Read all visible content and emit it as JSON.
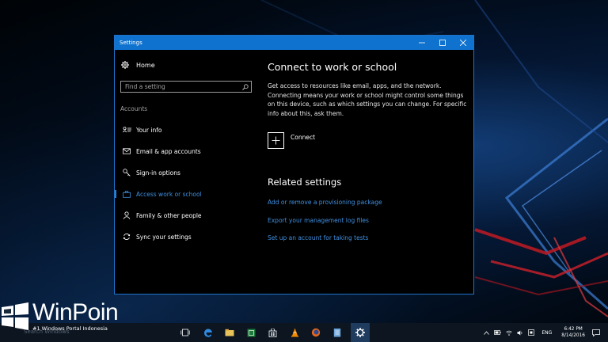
{
  "window": {
    "title": "Settings"
  },
  "sidebar": {
    "home_label": "Home",
    "search_placeholder": "Find a setting",
    "section_label": "Accounts",
    "items": [
      {
        "label": "Your info",
        "icon": "user-card-icon"
      },
      {
        "label": "Email & app accounts",
        "icon": "envelope-icon"
      },
      {
        "label": "Sign-in options",
        "icon": "key-icon"
      },
      {
        "label": "Access work or school",
        "icon": "briefcase-icon",
        "active": true
      },
      {
        "label": "Family & other people",
        "icon": "person-icon"
      },
      {
        "label": "Sync your settings",
        "icon": "sync-icon"
      }
    ]
  },
  "content": {
    "heading": "Connect to work or school",
    "description": "Get access to resources like email, apps, and the network. Connecting means your work or school might control some things on this device, such as which settings you can change. For specific info about this, ask them.",
    "connect_label": "Connect",
    "related_heading": "Related settings",
    "related_links": [
      "Add or remove a provisioning package",
      "Export your management log files",
      "Set up an account for taking tests"
    ]
  },
  "watermark": {
    "name": "WinPoin",
    "tagline": "#1 Windows Portal Indonesia"
  },
  "taskbar": {
    "search_text": "Search Windows",
    "language": "ENG",
    "time": "6:42 PM",
    "date": "8/14/2016"
  },
  "colors": {
    "accent": "#0f72cf",
    "link": "#3f8fe0",
    "window_bg": "#000000",
    "taskbar_bg": "#0c1520"
  }
}
